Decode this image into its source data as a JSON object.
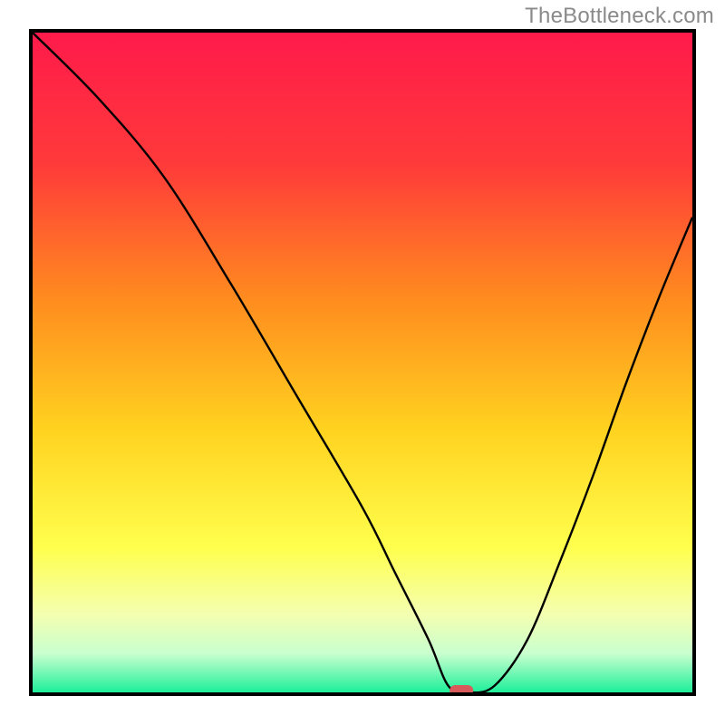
{
  "watermark": "TheBottleneck.com",
  "chart_data": {
    "type": "line",
    "title": "",
    "xlabel": "",
    "ylabel": "",
    "xlim": [
      0,
      100
    ],
    "ylim": [
      0,
      100
    ],
    "x": [
      0,
      10,
      20,
      30,
      40,
      50,
      55,
      60,
      63,
      66,
      70,
      75,
      80,
      85,
      90,
      95,
      100
    ],
    "values": [
      100,
      90,
      78,
      62,
      45,
      28,
      18,
      8,
      1,
      0,
      1,
      8,
      20,
      33,
      47,
      60,
      72
    ],
    "notch_point": {
      "x": 65,
      "y": 0
    },
    "gradient_stops": [
      {
        "offset": 0,
        "color": "#ff1a4b"
      },
      {
        "offset": 0.2,
        "color": "#ff3a3a"
      },
      {
        "offset": 0.4,
        "color": "#ff8a1f"
      },
      {
        "offset": 0.6,
        "color": "#ffd21f"
      },
      {
        "offset": 0.78,
        "color": "#ffff4d"
      },
      {
        "offset": 0.88,
        "color": "#f4ffb0"
      },
      {
        "offset": 0.94,
        "color": "#c9ffcf"
      },
      {
        "offset": 1.0,
        "color": "#19ef98"
      }
    ],
    "marker_color": "#d85a5a",
    "frame_color": "#000000"
  }
}
